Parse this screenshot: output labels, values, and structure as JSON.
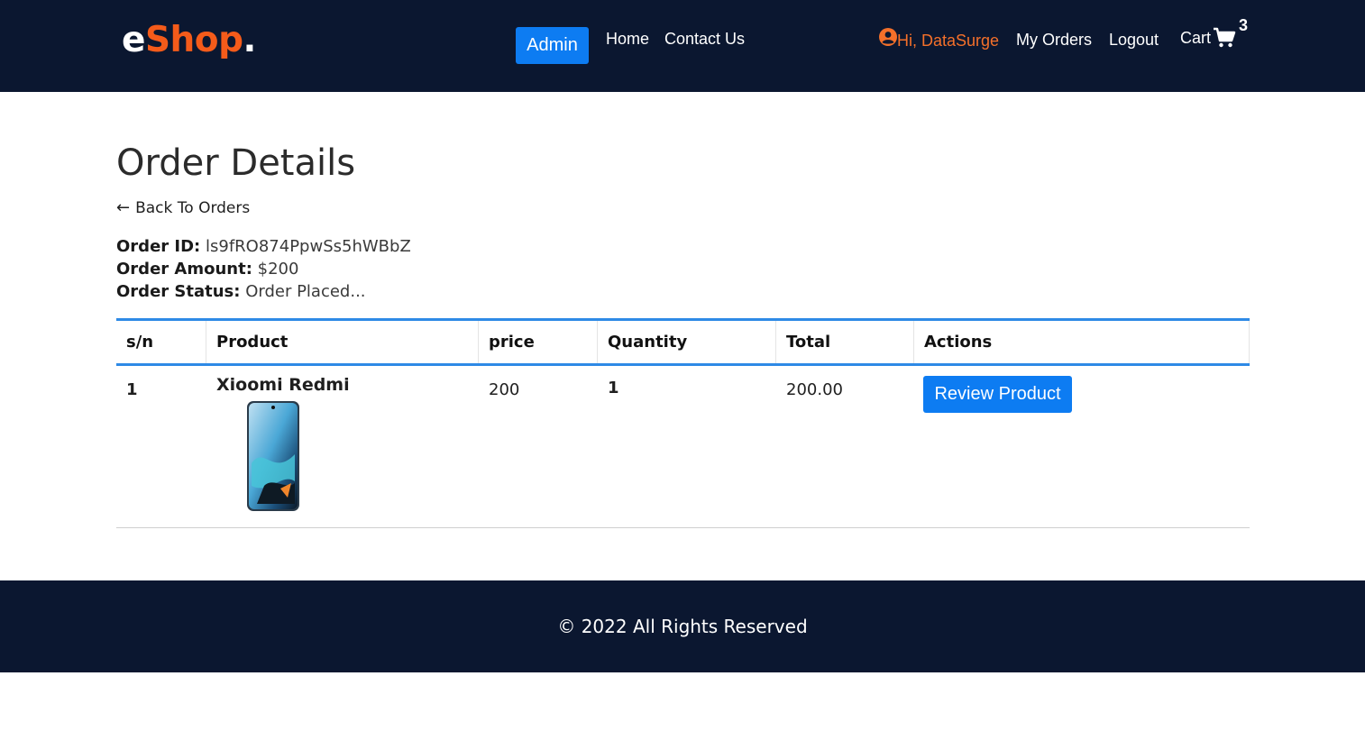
{
  "header": {
    "logo": {
      "prefix": "e",
      "brand": "Shop",
      "suffix": "."
    },
    "admin_label": "Admin",
    "nav": {
      "home": "Home",
      "contact": "Contact Us",
      "my_orders": "My Orders",
      "logout": "Logout"
    },
    "user_greeting": "Hi, DataSurge",
    "cart_label": "Cart",
    "cart_count": "3",
    "colors": {
      "background": "#0b1730",
      "accent": "#f45b1a",
      "button": "#0d7cf2"
    },
    "icons": {
      "user": "user-circle-icon",
      "cart": "shopping-cart-icon"
    }
  },
  "page": {
    "title": "Order Details",
    "back_link": "Back To Orders",
    "back_icon": "arrow-left-icon",
    "order": {
      "id_label": "Order ID:",
      "id_value": "ls9fRO874PpwSs5hWBbZ",
      "amount_label": "Order Amount:",
      "amount_value": "$200",
      "status_label": "Order Status:",
      "status_value": "Order Placed..."
    }
  },
  "table": {
    "columns": [
      "s/n",
      "Product",
      "price",
      "Quantity",
      "Total",
      "Actions"
    ],
    "rows": [
      {
        "sn": "1",
        "product": "Xioomi Redmi",
        "price": "200",
        "quantity": "1",
        "total": "200.00",
        "action": "Review Product"
      }
    ]
  },
  "footer": {
    "text": "© 2022  All Rights Reserved"
  }
}
